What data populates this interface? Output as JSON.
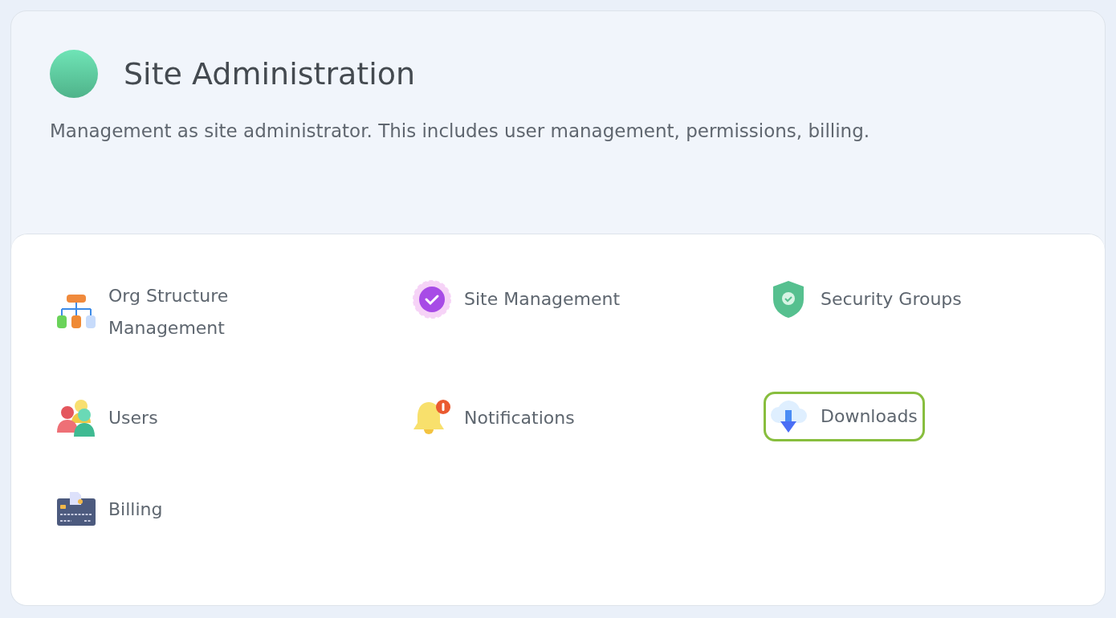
{
  "header": {
    "title": "Site Administration",
    "description": "Management as site administrator. This includes user management, permissions, billing."
  },
  "items": [
    {
      "kind": "org",
      "label": "Org Structure\nManagement",
      "selected": false
    },
    {
      "kind": "site",
      "label": "Site Management",
      "selected": false
    },
    {
      "kind": "security",
      "label": "Security Groups",
      "selected": false
    },
    {
      "kind": "users",
      "label": "Users",
      "selected": false
    },
    {
      "kind": "notifications",
      "label": "Notifications",
      "selected": false
    },
    {
      "kind": "downloads",
      "label": "Downloads",
      "selected": true
    },
    {
      "kind": "billing",
      "label": "Billing",
      "selected": false
    }
  ]
}
